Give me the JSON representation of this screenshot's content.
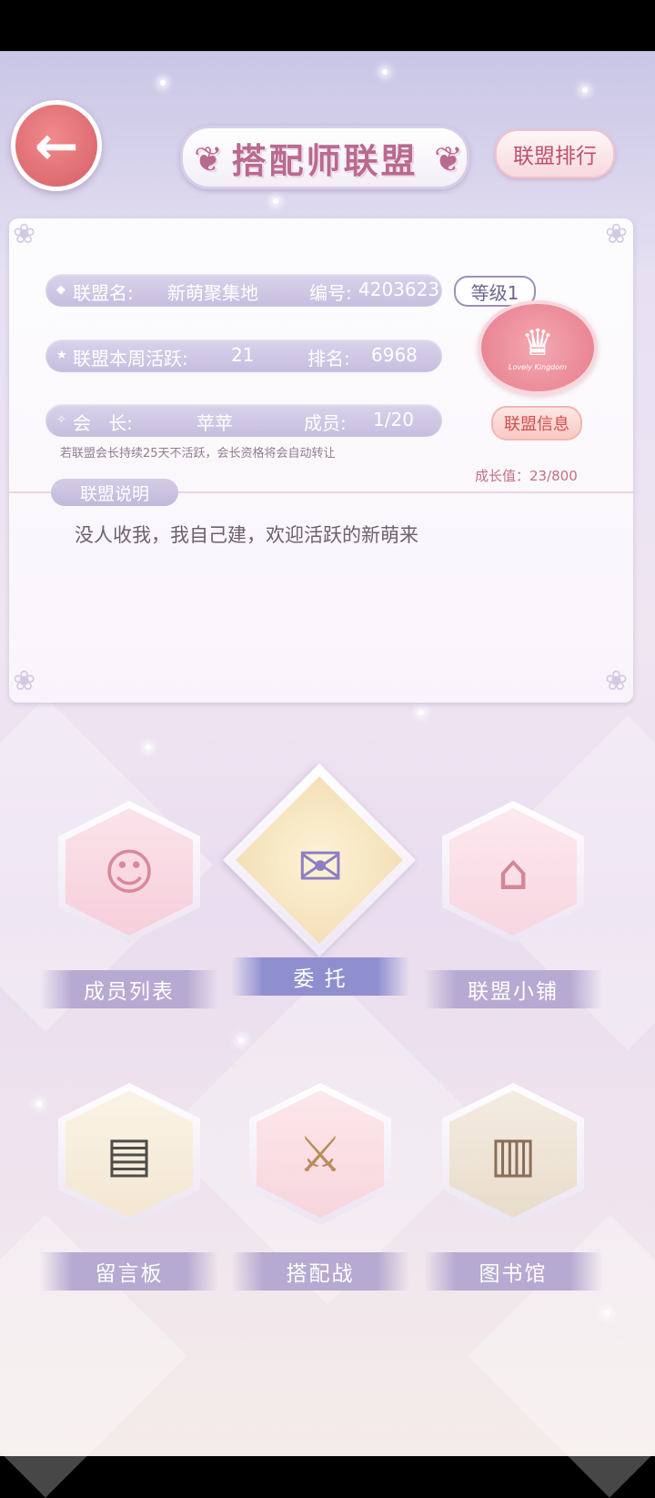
{
  "header": {
    "back_icon": "arrow-left-icon",
    "title": "搭配师联盟",
    "ranking_label": "联盟排行"
  },
  "alliance": {
    "name_label": "联盟名:",
    "name": "新萌聚集地",
    "id_label": "编号:",
    "id": "4203623",
    "weekly_active_label": "联盟本周活跃:",
    "weekly_active": "21",
    "rank_label": "排名:",
    "rank": "6968",
    "leader_label": "会   长:",
    "leader": "苹苹",
    "members_label": "成员:",
    "members": "1/20",
    "level": "等级1",
    "emblem_text": "Lovely Kingdom",
    "info_button": "联盟信息",
    "leader_transfer_note": "若联盟会长持续25天不活跃，会长资格将会自动转让",
    "growth": "成长值：23/800",
    "description_label": "联盟说明",
    "description": "没人收我，我自己建，欢迎活跃的新萌来"
  },
  "features": [
    {
      "label": "成员列表",
      "icon": "two-girls-icon"
    },
    {
      "label": "委 托",
      "icon": "envelope-quill-icon"
    },
    {
      "label": "联盟小铺",
      "icon": "shop-icon"
    },
    {
      "label": "留言板",
      "icon": "chalkboard-icon"
    },
    {
      "label": "搭配战",
      "icon": "crossed-swords-icon"
    },
    {
      "label": "图书馆",
      "icon": "bookshelf-icon"
    }
  ],
  "colors": {
    "accent_pink": "#d45f66",
    "pill_lavender": "#c7bedf",
    "label_purple": "#b6aad2",
    "title_pink": "#b96a8f"
  }
}
